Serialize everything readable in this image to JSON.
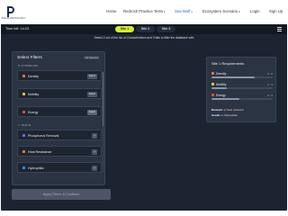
{
  "brand": {
    "name": "PALEONTOLOGY",
    "logo_color": "#1d2b4c"
  },
  "nav": {
    "home": "Home",
    "redrock": "Redrock Practice Tests",
    "sea_wolf": "Sea Wolf",
    "ecosystem": "Ecosystem Scenario",
    "login": "Login",
    "signup": "Sign Up",
    "active_color": "#2f62c6"
  },
  "app": {
    "timer": "Time left: 14:23",
    "tabs": [
      "Site 1",
      "Site 2",
      "Site 3"
    ],
    "active_tab": "Site 1",
    "accent": "#d6ec33",
    "instruction": "Select 2 out of the list of Characteristics and Traits to filter the database with"
  },
  "filters": {
    "title": "Select Filters",
    "count": "0/2 Selected",
    "attributes_heading": "ATTRIBUTES",
    "attributes": [
      {
        "label": "Density",
        "button": "Select",
        "icon": "density-icon",
        "color": "#e0743a"
      },
      {
        "label": "Mobility",
        "button": "Select",
        "icon": "mobility-icon",
        "color": "#e3c43a"
      },
      {
        "label": "Energy",
        "button": "Select",
        "icon": "energy-icon",
        "color": "#e04a3a"
      }
    ],
    "traits_heading": "TRAITS",
    "traits": [
      {
        "label": "Phosphorus Removal",
        "icon": "phosphorus-icon",
        "color": "#8a5bd6"
      },
      {
        "label": "Heat Resistance",
        "icon": "heat-icon",
        "color": "#e0743a"
      },
      {
        "label": "Hydrophilic",
        "icon": "hydrophilic-icon",
        "color": "#3a8ae0"
      }
    ],
    "apply_label": "Apply Filters & Continue"
  },
  "requirements": {
    "title": "Site 1 Requirements",
    "rows": [
      {
        "label": "Density",
        "range": "6 - 8",
        "level": 0.7,
        "icon": "density-icon",
        "color": "#e0743a"
      },
      {
        "label": "Mobility",
        "range": "0 - 3",
        "level": 0.25,
        "icon": "mobility-icon",
        "color": "#e3c43a"
      },
      {
        "label": "Energy",
        "range": "0 - 5",
        "level": 0.45,
        "icon": "energy-icon",
        "color": "#e04a3a"
      }
    ],
    "desired_label": "Desired:",
    "desired_value": "Heat resistant",
    "avoid_label": "Avoid:",
    "avoid_value": "Hydrophilic"
  }
}
